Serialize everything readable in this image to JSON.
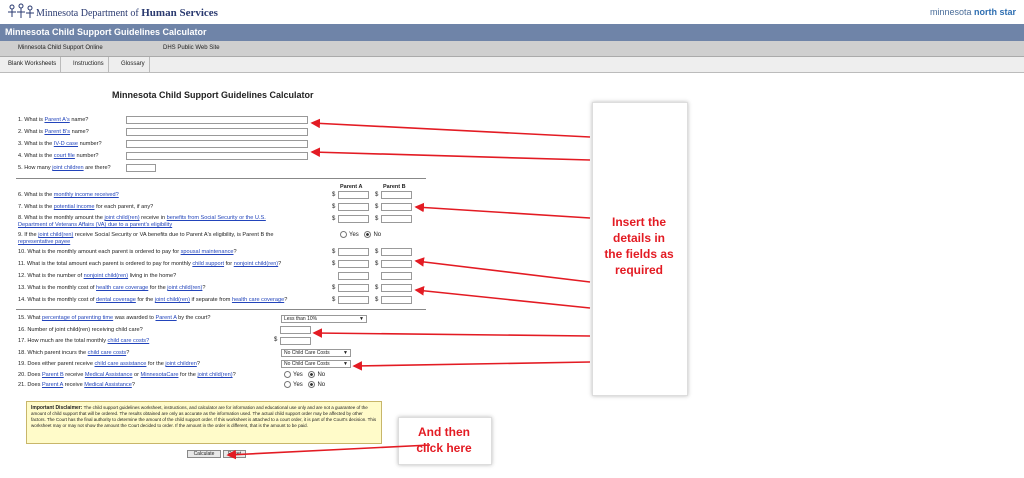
{
  "header": {
    "agency_prefix": "Minnesota Department of",
    "agency_name": "Human Services",
    "brand_prefix": "minnesota",
    "brand_name": "north star",
    "app_title": "Minnesota Child Support Guidelines Calculator"
  },
  "nav": [
    {
      "label": "Minnesota Child Support Online"
    },
    {
      "label": "DHS Public Web Site"
    }
  ],
  "subnav": [
    {
      "label": "Blank Worksheets"
    },
    {
      "label": "Instructions"
    },
    {
      "label": "Glossary"
    }
  ],
  "form": {
    "title": "Minnesota Child Support Guidelines Calculator",
    "col_a": "Parent A",
    "col_b": "Parent B",
    "currency": "$",
    "q1_pre": "1. What is ",
    "q1_link": "Parent A's",
    "q1_post": " name?",
    "q2_pre": "2. What is ",
    "q2_link": "Parent B's",
    "q2_post": " name?",
    "q3_pre": "3. What is the ",
    "q3_link": "IV-D case",
    "q3_post": " number?",
    "q4_pre": "4. What is the ",
    "q4_link": "court file",
    "q4_post": " number?",
    "q5_pre": "5. How many ",
    "q5_link": "joint children",
    "q5_post": " are there?",
    "q6_pre": "6. What is the ",
    "q6_link": "monthly income received?",
    "q7_pre": "7. What is the ",
    "q7_link": "potential income",
    "q7_post": " for each parent, if any?",
    "q8_pre": "8. What is the monthly amount the ",
    "q8_link1": "joint child(ren)",
    "q8_mid": " receive in ",
    "q8_link2": "benefits from Social Security or the U.S.",
    "q8_line2_link": "Department of Veterans Affairs (VA) due to a parent's eligibility",
    "q9_pre": "9. If the ",
    "q9_link": "joint child(ren)",
    "q9_post": " receive Social Security or VA benefits due to Parent A's eligibility, is Parent B the",
    "q9_line2_link": "representative payee",
    "q10_pre": "10. What is the monthly amount each parent is ordered to pay for ",
    "q10_link": "spousal maintenance",
    "q11_pre": "11. What is the total amount each parent is ordered to pay for monthly ",
    "q11_link1": "child support",
    "q11_mid": " for ",
    "q11_link2": "nonjoint child(ren)",
    "q12_pre": "12. What is the number of ",
    "q12_link": "nonjoint child(ren)",
    "q12_post": " living in the home?",
    "q13_pre": "13. What is the monthly cost of ",
    "q13_link1": "health care coverage",
    "q13_mid": " for the ",
    "q13_link2": "joint child(ren)",
    "q14_pre": "14. What is the monthly cost of ",
    "q14_link1": "dental coverage",
    "q14_mid": " for the ",
    "q14_link2": "joint child(ren)",
    "q14_mid2": " if separate from ",
    "q14_link3": "health care coverage",
    "q15_pre": "15. What ",
    "q15_link1": "percentage of parenting time",
    "q15_mid": " was awarded to ",
    "q15_link2": "Parent A",
    "q15_post": " by the court?",
    "q15_select": "Less than 10%",
    "q16": "16. Number of joint child(ren) receiving child care?",
    "q17_pre": "17. How much are the total monthly ",
    "q17_link": "child care costs?",
    "q18_pre": "18. Which parent incurs the ",
    "q18_link": "child care costs",
    "q18_select": "No Child Care Costs",
    "q19_pre": "19. Does either parent receive ",
    "q19_link1": "child care assistance",
    "q19_mid": " for the ",
    "q19_link2": "joint children",
    "q19_select": "No Child Care Costs",
    "q20_pre": "20. Does ",
    "q20_link1": "Parent B",
    "q20_mid": " receive ",
    "q20_link2": "Medical Assistance",
    "q20_mid2": " or ",
    "q20_link3": "MinnesotaCare",
    "q20_mid3": " for the ",
    "q20_link4": "joint child(ren)",
    "q21_pre": "21. Does ",
    "q21_link1": "Parent A",
    "q21_mid": " receive ",
    "q21_link2": "Medical Assistance",
    "yes": "Yes",
    "no": "No"
  },
  "disclaimer": {
    "label": "Important Disclaimer:",
    "text": "The child support guidelines worksheet, instructions, and calculator are for information and educational use only and are not a guarantee of the amount of child support that will be ordered. The results obtained are only as accurate as the information used. The actual child support order may be affected by other factors. The Court has the final authority to determine the amount of the child support order. If this worksheet is attached to a court order, it is part of the Court's decision. This worksheet may or may not show the amount the Court decided to order. If the amount in the order is different, that is the amount to be paid."
  },
  "buttons": {
    "calculate": "Calculate",
    "reset": "Reset"
  },
  "annotations": {
    "insert_l1": "Insert the",
    "insert_l2": "details in",
    "insert_l3": "the fields as",
    "insert_l4": "required",
    "then_l1": "And then",
    "then_l2": "click here",
    "color": "#e31b23"
  }
}
